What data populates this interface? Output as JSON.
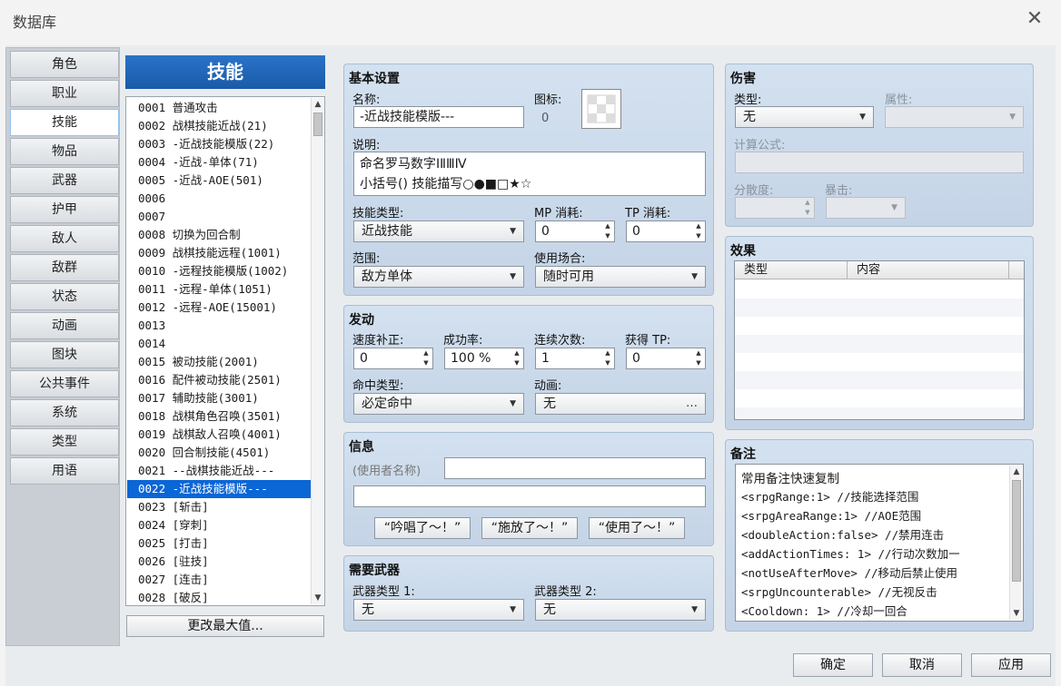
{
  "window": {
    "title": "数据库",
    "close_glyph": "✕"
  },
  "categories": [
    "角色",
    "职业",
    "技能",
    "物品",
    "武器",
    "护甲",
    "敌人",
    "敌群",
    "状态",
    "动画",
    "图块",
    "公共事件",
    "系统",
    "类型",
    "用语"
  ],
  "active_category": 2,
  "list": {
    "header": "技能",
    "selected_index": 21,
    "items": [
      "0001 普通攻击",
      "0002 战棋技能近战(21)",
      "0003 -近战技能模版(22)",
      "0004 -近战-单体(71)",
      "0005 -近战-AOE(501)",
      "0006",
      "0007",
      "0008 切换为回合制",
      "0009 战棋技能远程(1001)",
      "0010 -远程技能模版(1002)",
      "0011 -远程-单体(1051)",
      "0012 -远程-AOE(15001)",
      "0013",
      "0014",
      "0015 被动技能(2001)",
      "0016 配件被动技能(2501)",
      "0017 辅助技能(3001)",
      "0018 战棋角色召唤(3501)",
      "0019 战棋敌人召唤(4001)",
      "0020 回合制技能(4501)",
      "0021 --战棋技能近战---",
      "0022 -近战技能模版---",
      "0023 [斩击]",
      "0024 [穿刺]",
      "0025 [打击]",
      "0026 [驻技]",
      "0027 [连击]",
      "0028 [破反]"
    ],
    "change_max_label": "更改最大值..."
  },
  "basic": {
    "title": "基本设置",
    "name_label": "名称:",
    "name_value": "-近战技能模版---",
    "icon_label": "图标:",
    "icon_index": "0",
    "desc_label": "说明:",
    "desc_line1": "命名罗马数字ⅠⅡⅢⅣ",
    "desc_line2": "小括号() 技能描写○●■□★☆",
    "skilltype_label": "技能类型:",
    "skilltype_value": "近战技能",
    "mp_label": "MP 消耗:",
    "mp_value": "0",
    "tp_label": "TP 消耗:",
    "tp_value": "0",
    "scope_label": "范围:",
    "scope_value": "敌方单体",
    "occasion_label": "使用场合:",
    "occasion_value": "随时可用"
  },
  "invocation": {
    "title": "发动",
    "speed_label": "速度补正:",
    "speed_value": "0",
    "success_label": "成功率:",
    "success_value": "100 %",
    "repeats_label": "连续次数:",
    "repeats_value": "1",
    "tpgain_label": "获得 TP:",
    "tpgain_value": "0",
    "hittype_label": "命中类型:",
    "hittype_value": "必定命中",
    "anim_label": "动画:",
    "anim_value": "无",
    "anim_button": "…"
  },
  "message": {
    "title": "信息",
    "user_placeholder": "(使用者名称)",
    "line1_value": "",
    "line2_value": "",
    "btn1": "“吟唱了～！”",
    "btn2": "“施放了～！”",
    "btn3": "“使用了～！”"
  },
  "required_weapon": {
    "title": "需要武器",
    "w1_label": "武器类型 1:",
    "w1_value": "无",
    "w2_label": "武器类型 2:",
    "w2_value": "无"
  },
  "damage": {
    "title": "伤害",
    "type_label": "类型:",
    "type_value": "无",
    "element_label": "属性:",
    "element_value": "",
    "formula_label": "计算公式:",
    "formula_value": "",
    "variance_label": "分散度:",
    "variance_value": "",
    "critical_label": "暴击:",
    "critical_value": ""
  },
  "effects": {
    "title": "效果",
    "col_type": "类型",
    "col_content": "内容",
    "rows": []
  },
  "notes": {
    "title": "备注",
    "lines": [
      "常用备注快速复制",
      "<srpgRange:1> //技能选择范围",
      "<srpgAreaRange:1> //AOE范围",
      "<doubleAction:false> //禁用连击",
      "<addActionTimes: 1> //行动次数加一",
      "<notUseAfterMove> //移动后禁止使用",
      "<srpgUncounterable> //无视反击",
      "<Cooldown: 1> //冷却一回合"
    ]
  },
  "footer": {
    "ok": "确定",
    "cancel": "取消",
    "apply": "应用"
  }
}
